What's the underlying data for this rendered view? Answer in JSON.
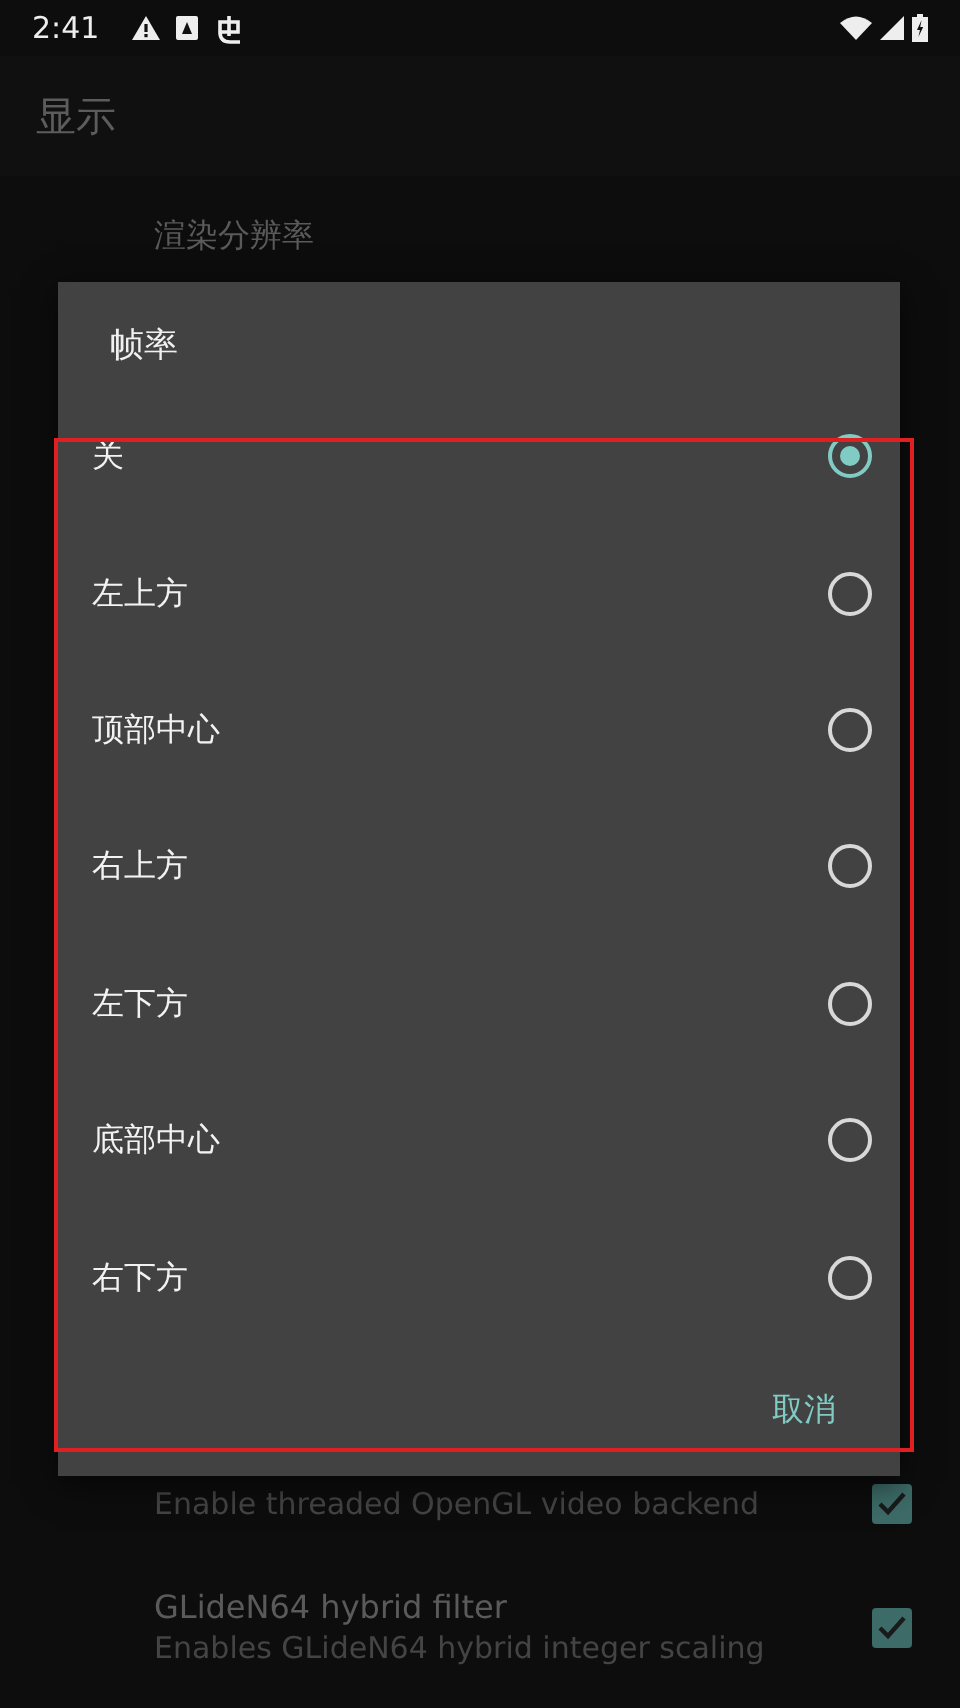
{
  "status_bar": {
    "time": "2:41"
  },
  "app_bar": {
    "title": "显示"
  },
  "settings_top": {
    "title": "渲染分辨率"
  },
  "settings_bottom": [
    {
      "summary": "Enable threaded OpenGL video backend",
      "checked": true
    },
    {
      "title": "GLideN64 hybrid filter",
      "summary": "Enables GLideN64 hybrid integer scaling",
      "checked": true
    }
  ],
  "dialog": {
    "title": "帧率",
    "options": [
      {
        "label": "关",
        "selected": true
      },
      {
        "label": "左上方",
        "selected": false
      },
      {
        "label": "顶部中心",
        "selected": false
      },
      {
        "label": "右上方",
        "selected": false
      },
      {
        "label": "左下方",
        "selected": false
      },
      {
        "label": "底部中心",
        "selected": false
      },
      {
        "label": "右下方",
        "selected": false
      }
    ],
    "cancel": "取消"
  }
}
